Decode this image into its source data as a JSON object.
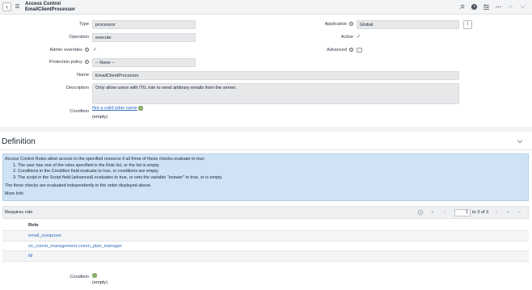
{
  "header": {
    "title": "Access Control",
    "subtitle": "EmailClientProcessor",
    "back_glyph": "‹",
    "icons": [
      "pin-icon",
      "help-icon",
      "settings-icon",
      "more-icon",
      "up-icon",
      "down-icon"
    ]
  },
  "form": {
    "type_label": "Type",
    "type_value": "processor",
    "operation_label": "Operation",
    "operation_value": "execute",
    "admin_overrides_label": "Admin overrides",
    "protection_policy_label": "Protection policy",
    "protection_policy_value": "-- None --",
    "name_label": "Name",
    "name_value": "EmailClientProcessor",
    "description_label": "Description",
    "description_value": "Only allow users with ITIL role to send arbitrary emails from the server.",
    "condition_label": "Condition",
    "condition_link": "Not a valid table name",
    "condition_empty": "(empty)",
    "application_label": "Application",
    "application_value": "Global",
    "active_label": "Active",
    "advanced_label": "Advanced",
    "help_glyph": "?",
    "check_glyph": "✓"
  },
  "definition": {
    "title": "Definition",
    "info_lines": [
      "Access Control Rules allow access to the specified resource if all three of these checks evaluate to true:",
      "1. The user has one of the roles specified in the Role list, or the list is empty.",
      "2. Conditions in the Condition field evaluate to true, or conditions are empty.",
      "3. The script in the Script field (advanced) evaluates to true, or sets the variable \"answer\" to true, or is empty.",
      "The three checks are evaluated independently in the order displayed above."
    ],
    "more_info": "More Info"
  },
  "related_list": {
    "title": "Requires role",
    "column_header": "Role",
    "rows": [
      "email_composer",
      "sn_comm_management.comm_plan_manager",
      "itil"
    ],
    "pager_current": "1",
    "pager_text": "to 3 of 3"
  },
  "bottom": {
    "condition_label": "Condition",
    "condition_empty": "(empty)"
  },
  "colors": {
    "link": "#2f6bbd",
    "info_background": "#cfe3f5",
    "field_background": "#e6e8ea"
  }
}
